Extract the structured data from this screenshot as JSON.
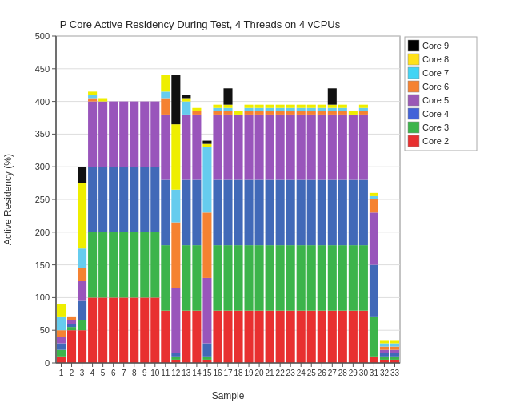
{
  "chart": {
    "title": "P Core Active Residency During Test, 4 Threads on 4 vCPUs",
    "xLabel": "Sample",
    "yLabel": "Active Residency (%)",
    "yMax": 500,
    "yMin": 0,
    "yTicks": [
      0,
      50,
      100,
      150,
      200,
      250,
      300,
      350,
      400,
      450,
      500
    ],
    "colors": {
      "core2": "#e83030",
      "core3": "#3cb44b",
      "core4": "#4363d8",
      "core5": "#9b59b6",
      "core6": "#f58231",
      "core7": "#42d4f4",
      "core8": "#ffe119",
      "core9": "#000000"
    },
    "legend": [
      {
        "label": "Core 9",
        "color": "#000000"
      },
      {
        "label": "Core 8",
        "color": "#ffe119"
      },
      {
        "label": "Core 7",
        "color": "#42d4f4"
      },
      {
        "label": "Core 6",
        "color": "#f58231"
      },
      {
        "label": "Core 5",
        "color": "#9b59b6"
      },
      {
        "label": "Core 4",
        "color": "#4363d8"
      },
      {
        "label": "Core 3",
        "color": "#3cb44b"
      },
      {
        "label": "Core 2",
        "color": "#e83030"
      }
    ],
    "samples": [
      {
        "x": 1,
        "c2": 10,
        "c3": 10,
        "c4": 10,
        "c5": 10,
        "c6": 10,
        "c7": 20,
        "c8": 20,
        "c9": 0
      },
      {
        "x": 2,
        "c2": 50,
        "c3": 5,
        "c4": 5,
        "c5": 5,
        "c6": 5,
        "c7": 0,
        "c8": 0,
        "c9": 0
      },
      {
        "x": 3,
        "c2": 50,
        "c3": 15,
        "c4": 30,
        "c5": 30,
        "c6": 20,
        "c7": 30,
        "c8": 100,
        "c9": 25
      },
      {
        "x": 4,
        "c2": 100,
        "c3": 100,
        "c4": 100,
        "c5": 100,
        "c6": 5,
        "c7": 5,
        "c8": 5,
        "c9": 0
      },
      {
        "x": 5,
        "c2": 100,
        "c3": 100,
        "c4": 100,
        "c5": 100,
        "c6": 0,
        "c7": 0,
        "c8": 5,
        "c9": 0
      },
      {
        "x": 6,
        "c2": 100,
        "c3": 100,
        "c4": 100,
        "c5": 100,
        "c6": 0,
        "c7": 0,
        "c8": 0,
        "c9": 0
      },
      {
        "x": 7,
        "c2": 100,
        "c3": 100,
        "c4": 100,
        "c5": 100,
        "c6": 0,
        "c7": 0,
        "c8": 0,
        "c9": 0
      },
      {
        "x": 8,
        "c2": 100,
        "c3": 100,
        "c4": 100,
        "c5": 100,
        "c6": 0,
        "c7": 0,
        "c8": 0,
        "c9": 0
      },
      {
        "x": 9,
        "c2": 100,
        "c3": 100,
        "c4": 100,
        "c5": 100,
        "c6": 0,
        "c7": 0,
        "c8": 0,
        "c9": 0
      },
      {
        "x": 10,
        "c2": 100,
        "c3": 100,
        "c4": 100,
        "c5": 100,
        "c6": 0,
        "c7": 0,
        "c8": 0,
        "c9": 0
      },
      {
        "x": 11,
        "c2": 80,
        "c3": 100,
        "c4": 100,
        "c5": 100,
        "c6": 25,
        "c7": 10,
        "c8": 25,
        "c9": 0
      },
      {
        "x": 12,
        "c2": 5,
        "c3": 5,
        "c4": 5,
        "c5": 100,
        "c6": 100,
        "c7": 50,
        "c8": 100,
        "c9": 75
      },
      {
        "x": 13,
        "c2": 80,
        "c3": 100,
        "c4": 100,
        "c5": 100,
        "c6": 0,
        "c7": 20,
        "c8": 5,
        "c9": 5
      },
      {
        "x": 14,
        "c2": 80,
        "c3": 100,
        "c4": 100,
        "c5": 100,
        "c6": 5,
        "c7": 0,
        "c8": 5,
        "c9": 0
      },
      {
        "x": 15,
        "c2": 5,
        "c3": 5,
        "c4": 20,
        "c5": 100,
        "c6": 100,
        "c7": 100,
        "c8": 5,
        "c9": 5
      },
      {
        "x": 16,
        "c2": 80,
        "c3": 100,
        "c4": 100,
        "c5": 100,
        "c6": 5,
        "c7": 5,
        "c8": 5,
        "c9": 0
      },
      {
        "x": 17,
        "c2": 80,
        "c3": 100,
        "c4": 100,
        "c5": 100,
        "c6": 5,
        "c7": 5,
        "c8": 5,
        "c9": 25
      },
      {
        "x": 18,
        "c2": 80,
        "c3": 100,
        "c4": 100,
        "c5": 100,
        "c6": 0,
        "c7": 0,
        "c8": 5,
        "c9": 0
      },
      {
        "x": 19,
        "c2": 80,
        "c3": 100,
        "c4": 100,
        "c5": 100,
        "c6": 5,
        "c7": 5,
        "c8": 5,
        "c9": 0
      },
      {
        "x": 20,
        "c2": 80,
        "c3": 100,
        "c4": 100,
        "c5": 100,
        "c6": 5,
        "c7": 5,
        "c8": 5,
        "c9": 0
      },
      {
        "x": 21,
        "c2": 80,
        "c3": 100,
        "c4": 100,
        "c5": 100,
        "c6": 5,
        "c7": 5,
        "c8": 5,
        "c9": 0
      },
      {
        "x": 22,
        "c2": 80,
        "c3": 100,
        "c4": 100,
        "c5": 100,
        "c6": 5,
        "c7": 5,
        "c8": 5,
        "c9": 0
      },
      {
        "x": 23,
        "c2": 80,
        "c3": 100,
        "c4": 100,
        "c5": 100,
        "c6": 5,
        "c7": 5,
        "c8": 5,
        "c9": 0
      },
      {
        "x": 24,
        "c2": 80,
        "c3": 100,
        "c4": 100,
        "c5": 100,
        "c6": 5,
        "c7": 5,
        "c8": 5,
        "c9": 0
      },
      {
        "x": 25,
        "c2": 80,
        "c3": 100,
        "c4": 100,
        "c5": 100,
        "c6": 5,
        "c7": 5,
        "c8": 5,
        "c9": 0
      },
      {
        "x": 26,
        "c2": 80,
        "c3": 100,
        "c4": 100,
        "c5": 100,
        "c6": 5,
        "c7": 5,
        "c8": 5,
        "c9": 0
      },
      {
        "x": 27,
        "c2": 80,
        "c3": 100,
        "c4": 100,
        "c5": 100,
        "c6": 5,
        "c7": 5,
        "c8": 5,
        "c9": 25
      },
      {
        "x": 28,
        "c2": 80,
        "c3": 100,
        "c4": 100,
        "c5": 100,
        "c6": 5,
        "c7": 5,
        "c8": 5,
        "c9": 0
      },
      {
        "x": 29,
        "c2": 80,
        "c3": 100,
        "c4": 100,
        "c5": 100,
        "c6": 0,
        "c7": 0,
        "c8": 5,
        "c9": 0
      },
      {
        "x": 30,
        "c2": 80,
        "c3": 100,
        "c4": 100,
        "c5": 100,
        "c6": 5,
        "c7": 5,
        "c8": 5,
        "c9": 0
      },
      {
        "x": 31,
        "c2": 10,
        "c3": 60,
        "c4": 80,
        "c5": 80,
        "c6": 20,
        "c7": 5,
        "c8": 5,
        "c9": 0
      },
      {
        "x": 32,
        "c2": 5,
        "c3": 5,
        "c4": 5,
        "c5": 5,
        "c6": 5,
        "c7": 5,
        "c8": 5,
        "c9": 0
      },
      {
        "x": 33,
        "c2": 5,
        "c3": 5,
        "c4": 5,
        "c5": 5,
        "c6": 5,
        "c7": 5,
        "c8": 5,
        "c9": 0
      }
    ]
  }
}
